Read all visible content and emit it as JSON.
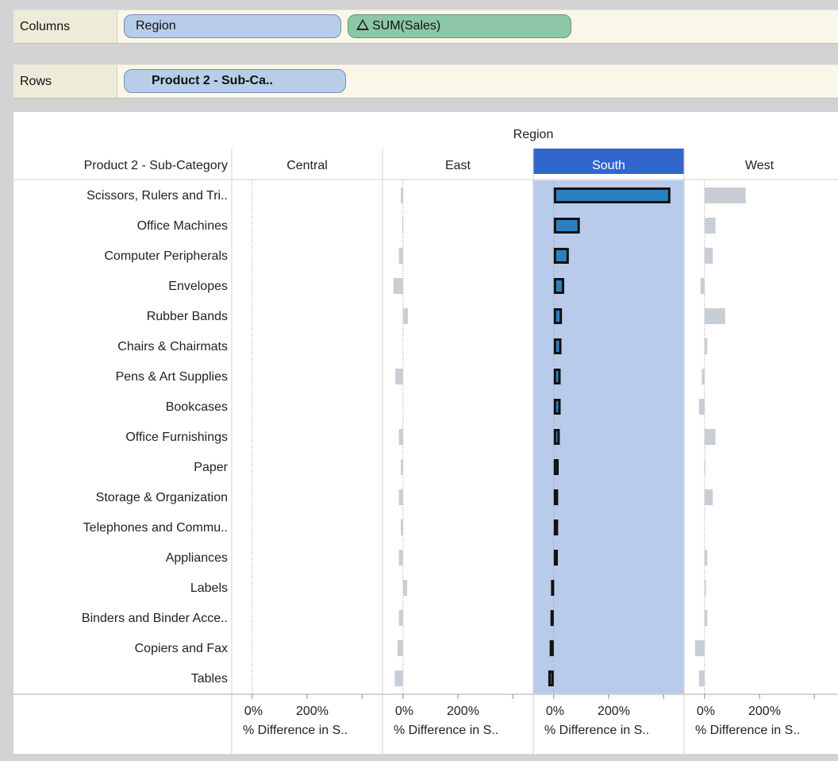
{
  "shelves": {
    "columns": {
      "label": "Columns",
      "pills": [
        "Region",
        "SUM(Sales)"
      ]
    },
    "rows": {
      "label": "Rows",
      "pills": [
        "Product 2 - Sub-Ca.."
      ]
    }
  },
  "colors": {
    "highlight_header": "#3366cc",
    "highlight_column": "#b8cbea",
    "selected_bar": "#2b80c0",
    "selected_bar_outline": "#111111",
    "faded_bar": "#c8ced6"
  },
  "chart_data": {
    "type": "bar",
    "orientation": "horizontal",
    "column_header_title": "Region",
    "row_header_title": "Product 2 - Sub-Category",
    "highlighted_panel": "South",
    "axis_tick_labels": [
      "0%",
      "200%"
    ],
    "axis_title": "% Difference in S..",
    "xlim": [
      -40,
      440
    ],
    "categories": [
      "Scissors, Rulers and Tri..",
      "Office Machines",
      "Computer Peripherals",
      "Envelopes",
      "Rubber Bands",
      "Chairs & Chairmats",
      "Pens & Art Supplies",
      "Bookcases",
      "Office Furnishings",
      "Paper",
      "Storage & Organization",
      "Telephones and Commu..",
      "Appliances",
      "Labels",
      "Binders and Binder Acce..",
      "Copiers and Fax",
      "Tables"
    ],
    "series": [
      {
        "name": "Central",
        "values": [
          0,
          0,
          0,
          0,
          0,
          0,
          0,
          0,
          0,
          0,
          0,
          0,
          0,
          0,
          0,
          0,
          0
        ]
      },
      {
        "name": "East",
        "values": [
          -8,
          -3,
          -15,
          -35,
          18,
          0,
          -28,
          0,
          -15,
          -8,
          -15,
          -8,
          -15,
          15,
          -15,
          -20,
          -30
        ]
      },
      {
        "name": "South",
        "values": [
          425,
          95,
          55,
          38,
          30,
          28,
          25,
          25,
          22,
          18,
          16,
          16,
          15,
          -10,
          -12,
          -15,
          -20
        ]
      },
      {
        "name": "West",
        "values": [
          150,
          40,
          30,
          -15,
          75,
          10,
          -10,
          -20,
          40,
          2,
          30,
          0,
          10,
          5,
          10,
          -35,
          -20
        ]
      }
    ]
  }
}
